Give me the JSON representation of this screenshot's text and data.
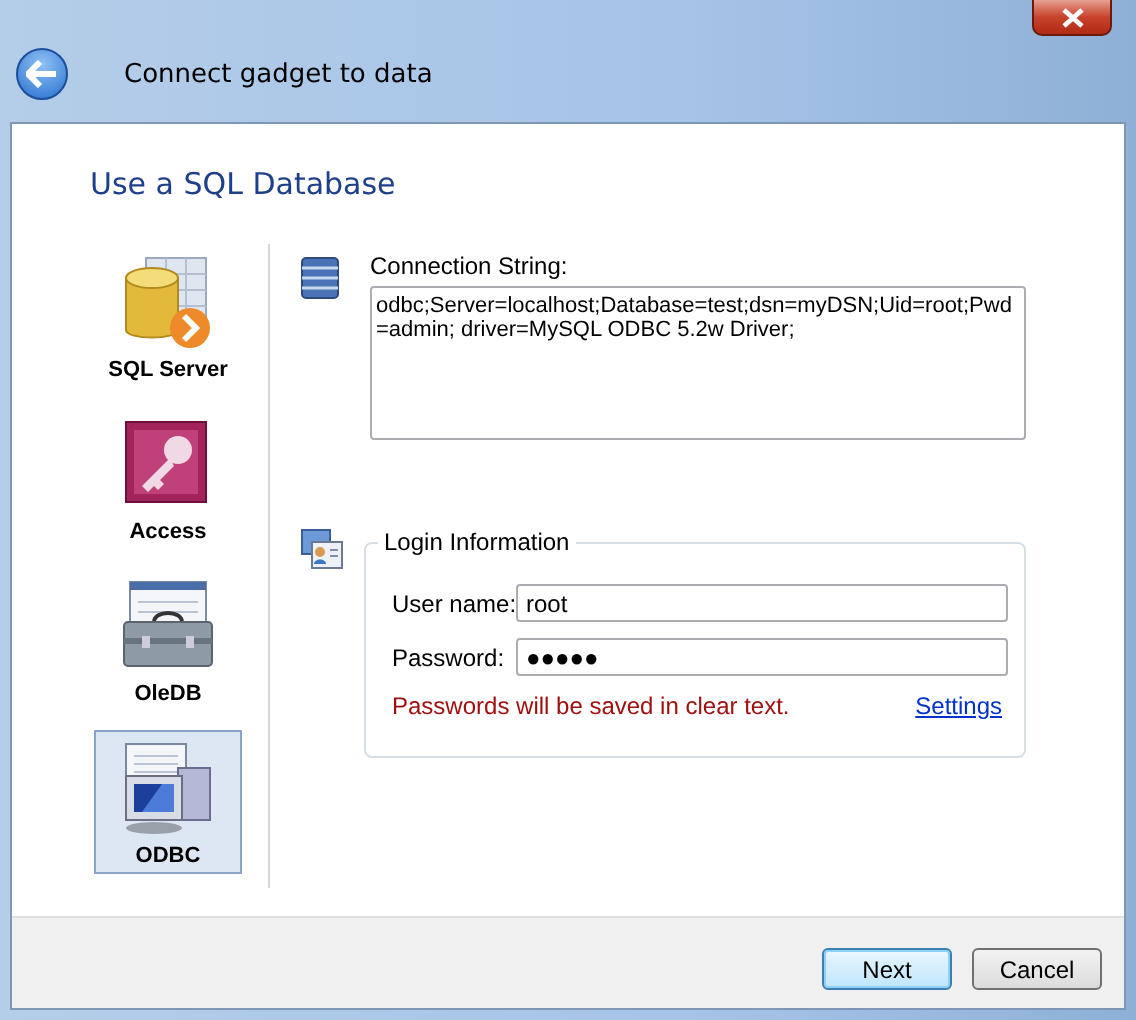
{
  "window": {
    "title": "Connect gadget to data"
  },
  "heading": "Use a SQL Database",
  "sources": [
    {
      "label": "SQL Server",
      "kind": "database",
      "selected": false
    },
    {
      "label": "Access",
      "kind": "key",
      "selected": false
    },
    {
      "label": "OleDB",
      "kind": "toolbox",
      "selected": false
    },
    {
      "label": "ODBC",
      "kind": "computer",
      "selected": true
    }
  ],
  "connection": {
    "label": "Connection String:",
    "value": "odbc;Server=localhost;Database=test;dsn=myDSN;Uid=root;Pwd=admin; driver=MySQL ODBC 5.2w Driver;"
  },
  "login": {
    "legend": "Login Information",
    "fields": [
      {
        "label": "User name:",
        "value": "root"
      },
      {
        "label": "Password:",
        "value": "●●●●●"
      }
    ],
    "warning": "Passwords will be saved in clear text.",
    "link": "Settings"
  },
  "buttons": [
    {
      "label": "Next",
      "default": true
    },
    {
      "label": "Cancel",
      "default": false
    }
  ]
}
